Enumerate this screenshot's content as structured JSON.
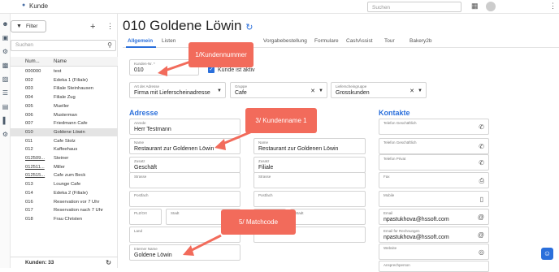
{
  "app": {
    "breadcrumb_icon": "person-icon",
    "breadcrumb": "Kunde",
    "search_placeholder": "Suchen"
  },
  "left": {
    "filter_label": "Filter",
    "search_placeholder": "Suchen",
    "col_num": "Num...",
    "col_name": "Name",
    "footer": "Kunden: 33",
    "rows": [
      {
        "num": "000000",
        "name": "test",
        "sel": false,
        "u": false
      },
      {
        "num": "002",
        "name": "Edeka 1 (Filiale)",
        "sel": false,
        "u": false
      },
      {
        "num": "003",
        "name": "Filiale Steinhausen",
        "sel": false,
        "u": false
      },
      {
        "num": "004",
        "name": "Filiale Zug",
        "sel": false,
        "u": false
      },
      {
        "num": "005",
        "name": "Mueller",
        "sel": false,
        "u": false
      },
      {
        "num": "006",
        "name": "Musterman",
        "sel": false,
        "u": false
      },
      {
        "num": "007",
        "name": "Friedmann Cafe",
        "sel": false,
        "u": false
      },
      {
        "num": "010",
        "name": "Goldene Löwin",
        "sel": true,
        "u": false
      },
      {
        "num": "011",
        "name": "Cafe Stolz",
        "sel": false,
        "u": false
      },
      {
        "num": "012",
        "name": "Kaffeehaus",
        "sel": false,
        "u": false
      },
      {
        "num": "012509...",
        "name": "Steiner",
        "sel": false,
        "u": true
      },
      {
        "num": "012511...",
        "name": "Miller",
        "sel": false,
        "u": true
      },
      {
        "num": "012515...",
        "name": "Cafe zum Beck",
        "sel": false,
        "u": true
      },
      {
        "num": "013",
        "name": "Lounge Cafe",
        "sel": false,
        "u": false
      },
      {
        "num": "014",
        "name": "Edeka 2 (Filiale)",
        "sel": false,
        "u": false
      },
      {
        "num": "016",
        "name": "Reservation vor 7 Uhr",
        "sel": false,
        "u": false
      },
      {
        "num": "017",
        "name": "Reservation nach 7 Uhr",
        "sel": false,
        "u": false
      },
      {
        "num": "018",
        "name": "Frau Christen",
        "sel": false,
        "u": false
      }
    ]
  },
  "main": {
    "title": "010 Goldene Löwin",
    "tabs": [
      "Allgemein",
      "Listen",
      "Vorgabebestellung",
      "Formulare",
      "CashAssist",
      "Tour",
      "Bakery2b"
    ],
    "kundennr_label": "Kunden-Nr. *",
    "kundennr": "010",
    "aktiv": "Kunde ist aktiv",
    "adressart_label": "Art der Adresse",
    "adressart": "Firma mit Lieferscheinadresse",
    "gruppe_label": "Gruppe",
    "gruppe": "Cafe",
    "lsg_label": "Lieferscheingruppe",
    "lsg": "Grosskunden",
    "adresse": "Adresse",
    "kontakte": "Kontakte",
    "anrede_label": "Anrede",
    "anrede": "Herr Testmann",
    "name_label": "Name",
    "name_l": "Restaurant zur Goldenen Löwin",
    "name_r": "Restaurant zur Goldenen Löwin",
    "zusatz_label": "Zusatz",
    "zusatz_l": "Geschäft",
    "zusatz_r": "Filiale",
    "strasse_label": "Strasse",
    "postfach_label": "Postfach",
    "plz_label": "PLZ/Ort",
    "stadt_label": "Stadt",
    "land_label": "Land",
    "intname_label": "Interner Name",
    "intname": "Goldene Löwin",
    "tel_g": "Telefon Geschäftlich",
    "tel_g2": "Telefon Geschäftlich",
    "tel_p": "Telefon Privat",
    "fax": "Fax",
    "mobile": "Mobile",
    "email_label": "Email",
    "email": "npastukhova@hssoft.com",
    "email2_label": "Email für Rechnungen",
    "email2": "npastukhova@hssoft.com",
    "website": "Website",
    "ansprech": "Ansprechperson"
  },
  "ann": {
    "a1": "1/Kundennummer",
    "a3": "3/ Kundenname 1",
    "a5": "5/ Matchcode",
    "color": "#f26b5b"
  }
}
